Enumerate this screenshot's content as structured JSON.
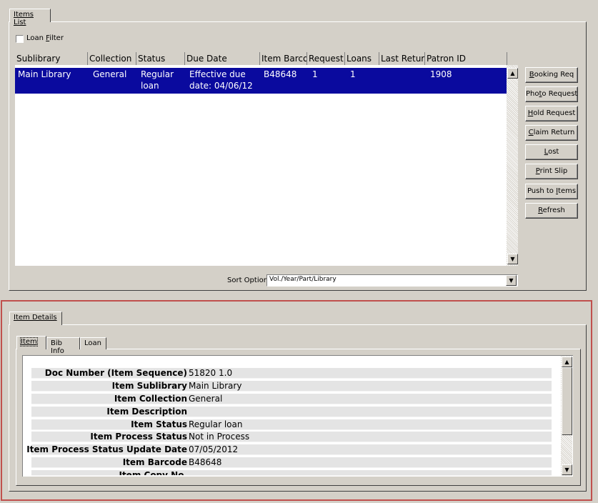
{
  "items_list": {
    "tab_label": "Items List",
    "loan_filter_label": "Loan Filter",
    "loan_filter_checked": false,
    "columns": [
      "Sublibrary",
      "Collection",
      "Status",
      "Due Date",
      "Item Barco",
      "Request",
      "Loans",
      "Last Retur",
      "Patron ID"
    ],
    "rows": [
      {
        "sublibrary": "Main Library",
        "collection": "General",
        "status_l1": "Regular",
        "status_l2": "loan",
        "due_l1": "Effective due",
        "due_l2": "date: 04/06/12",
        "barcode": "B48648",
        "request": "1",
        "loans": "1",
        "last_return": "",
        "patron_id": "1908"
      }
    ],
    "sort_options_label": "Sort Options",
    "sort_options_value": "Vol./Year/Part/Library",
    "buttons": [
      "Booking Req",
      "Photo Request",
      "Hold Request",
      "Claim Return",
      "Lost",
      "Print Slip",
      "Push to Items",
      "Refresh"
    ]
  },
  "item_details": {
    "tab_label": "Item Details",
    "subtabs": [
      "Item",
      "Bib Info",
      "Loan"
    ],
    "active_subtab": "Item",
    "fields": [
      {
        "label": "Doc Number (Item Sequence)",
        "value": "51820 1.0"
      },
      {
        "label": "Item Sublibrary",
        "value": "Main Library"
      },
      {
        "label": "Item Collection",
        "value": "General"
      },
      {
        "label": "Item Description",
        "value": ""
      },
      {
        "label": "Item Status",
        "value": "Regular loan"
      },
      {
        "label": "Item Process Status",
        "value": "Not in Process"
      },
      {
        "label": "Item Process Status Update Date",
        "value": "07/05/2012"
      },
      {
        "label": "Item Barcode",
        "value": "B48648"
      },
      {
        "label": "Item Copy No.",
        "value": ""
      }
    ]
  },
  "colors": {
    "selection": "#0a0a9e",
    "face": "#d4d0c8",
    "focus_border": "#c0504d"
  }
}
